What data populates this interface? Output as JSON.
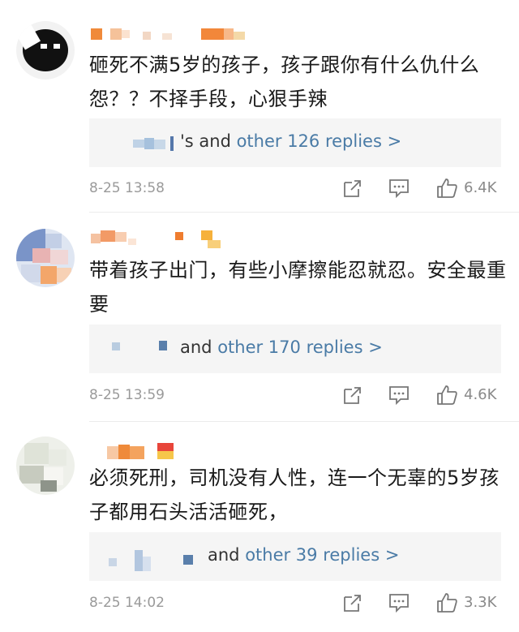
{
  "comments": [
    {
      "text": "砸死不满5岁的孩子，孩子跟你有什么仇什么怨？？不择手段，心狠手辣",
      "replies": {
        "prefix": "'s and ",
        "link": "other 126 replies >"
      },
      "timestamp": "8-25 13:58",
      "likes": "6.4K"
    },
    {
      "text": "带着孩子出门，有些小摩擦能忍就忍。安全最重要",
      "replies": {
        "prefix": "and ",
        "link": "other 170 replies >"
      },
      "timestamp": "8-25 13:59",
      "likes": "4.6K"
    },
    {
      "text": "必须死刑，司机没有人性，连一个无辜的5岁孩子都用石头活活砸死，",
      "replies": {
        "prefix": "and ",
        "link": "other 39 replies >"
      },
      "timestamp": "8-25 14:02",
      "likes": "3.3K"
    }
  ],
  "icons": {
    "share": "share-icon",
    "comment": "comment-icon",
    "like": "like-icon"
  },
  "colors": {
    "link": "#4a7ba6",
    "meta": "#9a9a9a",
    "reply_bg": "#f5f5f5"
  }
}
